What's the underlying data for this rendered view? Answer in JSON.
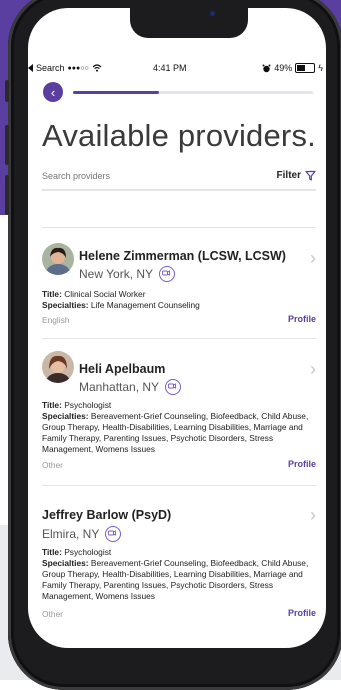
{
  "status_bar": {
    "carrier": "Search",
    "signal": "●●●○○",
    "time": "4:41 PM",
    "battery": "49%"
  },
  "header": {
    "title": "Available providers.",
    "progress_fraction": 0.36
  },
  "search": {
    "placeholder": "Search providers",
    "filter_label": "Filter"
  },
  "providers": [
    {
      "name": "Helene Zimmerman (LCSW, LCSW)",
      "location": "New York, NY",
      "title_label": "Title:",
      "title_value": "Clinical Social Worker",
      "specialties_label": "Specialties:",
      "specialties_value": "Life Management Counseling",
      "language": "English",
      "profile_label": "Profile"
    },
    {
      "name": "Heli Apelbaum",
      "location": "Manhattan, NY",
      "title_label": "Title:",
      "title_value": "Psychologist",
      "specialties_label": "Specialties:",
      "specialties_value": "Bereavement-Grief Counseling, Biofeedback, Child Abuse, Group Therapy, Health-Disabilities, Learning Disabilities, Marriage and Family Therapy, Parenting Issues, Psychotic Disorders, Stress Management, Womens Issues",
      "language": "Other",
      "profile_label": "Profile"
    },
    {
      "name": "Jeffrey  Barlow (PsyD)",
      "location": "Elmira, NY",
      "title_label": "Title:",
      "title_value": "Psychologist",
      "specialties_label": "Specialties:",
      "specialties_value": "Bereavement-Grief Counseling, Biofeedback, Child Abuse, Group Therapy, Health-Disabilities, Learning Disabilities, Marriage and Family Therapy, Parenting Issues, Psychotic Disorders, Stress Management, Womens Issues",
      "language": "Other",
      "profile_label": "Profile"
    }
  ],
  "colors": {
    "brand": "#5b3fa0",
    "link": "#5b3fa0"
  },
  "icons": {
    "back": "chevron-left-icon",
    "filter": "funnel-icon",
    "video": "video-camera-icon",
    "row": "chevron-right-icon"
  }
}
